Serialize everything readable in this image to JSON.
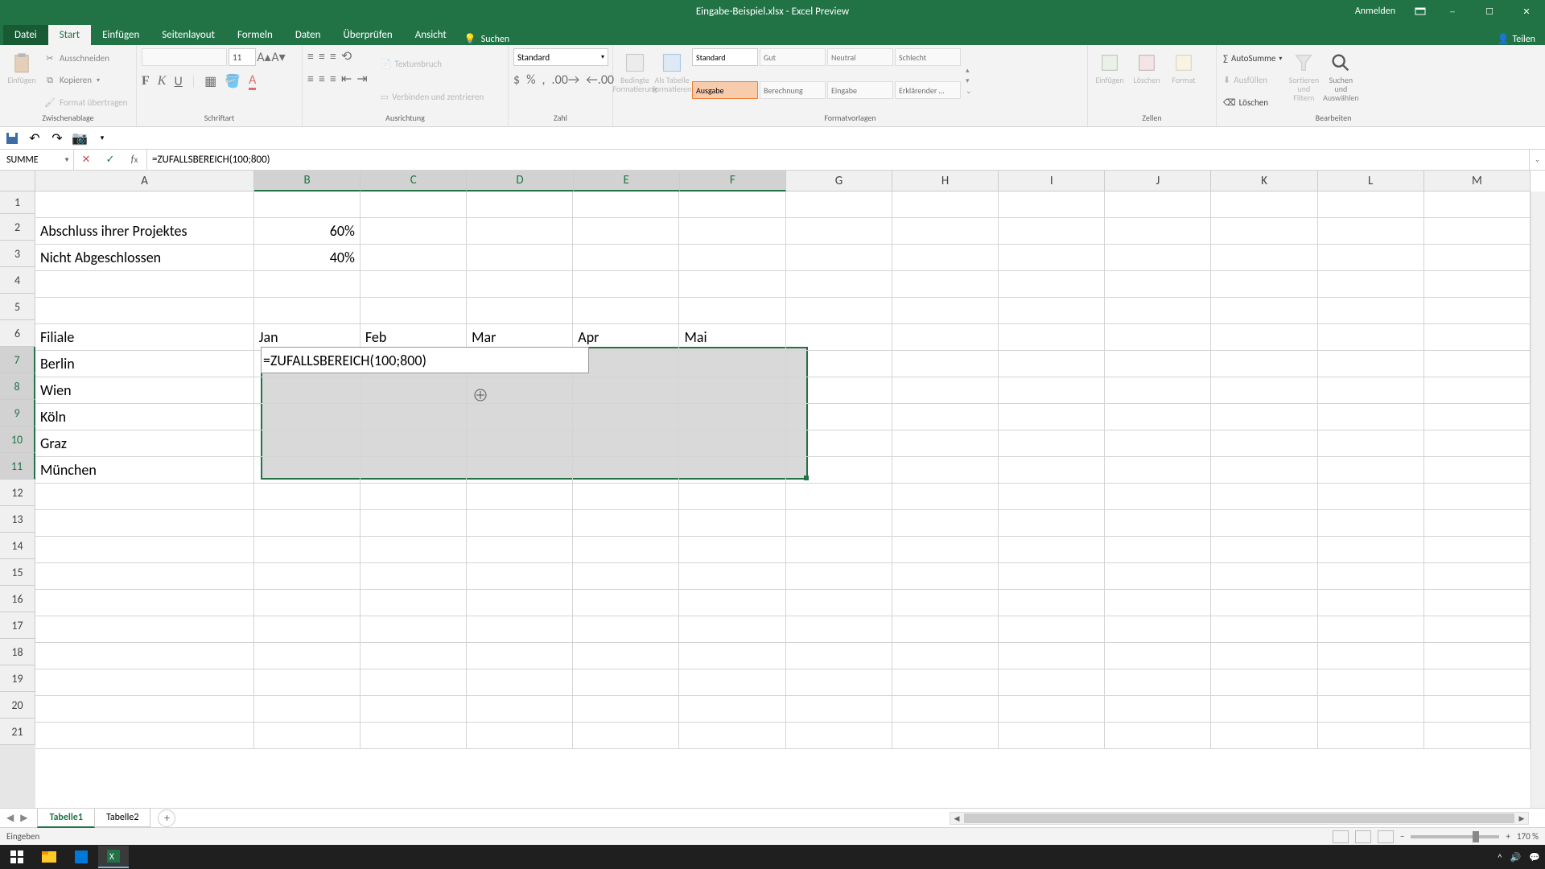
{
  "title": "Eingabe-Beispiel.xlsx - Excel Preview",
  "auth": {
    "signin": "Anmelden"
  },
  "tabs": {
    "datei": "Datei",
    "start": "Start",
    "einfuegen": "Einfügen",
    "seitenlayout": "Seitenlayout",
    "formeln": "Formeln",
    "daten": "Daten",
    "ueberpruefen": "Überprüfen",
    "ansicht": "Ansicht",
    "suchen": "Suchen",
    "teilen": "Teilen"
  },
  "ribbon": {
    "clipboard": {
      "label": "Zwischenablage",
      "einfuegen": "Einfügen",
      "ausschneiden": "Ausschneiden",
      "kopieren": "Kopieren",
      "format": "Format übertragen"
    },
    "font": {
      "label": "Schriftart",
      "size": "11"
    },
    "align": {
      "label": "Ausrichtung",
      "wrap": "Textumbruch",
      "merge": "Verbinden und zentrieren"
    },
    "number": {
      "label": "Zahl",
      "format": "Standard"
    },
    "styles": {
      "label": "Formatvorlagen",
      "cond": "Bedingte Formatierung",
      "table": "Als Tabelle formatieren",
      "items": [
        "Standard",
        "Gut",
        "Neutral",
        "Schlecht",
        "Ausgabe",
        "Berechnung",
        "Eingabe",
        "Erklärender …"
      ]
    },
    "cells": {
      "label": "Zellen",
      "insert": "Einfügen",
      "delete": "Löschen",
      "format": "Format"
    },
    "editing": {
      "label": "Bearbeiten",
      "autosum": "AutoSumme",
      "fill": "Ausfüllen",
      "clear": "Löschen",
      "sort": "Sortieren und Filtern",
      "find": "Suchen und Auswählen"
    }
  },
  "namebox": "SUMME",
  "formula": "=ZUFALLSBEREICH(100;800)",
  "columns": [
    "A",
    "B",
    "C",
    "D",
    "E",
    "F",
    "G",
    "H",
    "I",
    "J",
    "K",
    "L",
    "M"
  ],
  "rows_visible": 21,
  "data": {
    "A2": "Abschluss ihrer Projektes",
    "B2": "60%",
    "A3": "Nicht Abgeschlossen",
    "B3": "40%",
    "A6": "Filiale",
    "B6": "Jan",
    "C6": "Feb",
    "D6": "Mar",
    "E6": "Apr",
    "F6": "Mai",
    "A7": "Berlin",
    "A8": "Wien",
    "A9": "Köln",
    "A10": "Graz",
    "A11": "München",
    "B7_edit": "=ZUFALLSBEREICH(100;800)"
  },
  "sheets": {
    "tab1": "Tabelle1",
    "tab2": "Tabelle2"
  },
  "status": {
    "mode": "Eingeben",
    "zoom": "170 %"
  }
}
